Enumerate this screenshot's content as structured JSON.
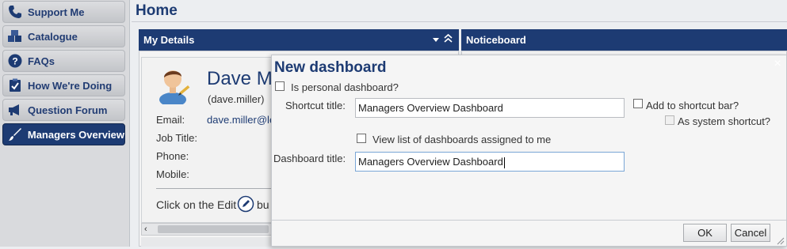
{
  "sidebar": {
    "items": [
      {
        "label": "Support Me",
        "icon": "phone-icon"
      },
      {
        "label": "Catalogue",
        "icon": "boxes-icon"
      },
      {
        "label": "FAQs",
        "icon": "question-icon"
      },
      {
        "label": "How We're Doing",
        "icon": "clipboard-icon"
      },
      {
        "label": "Question Forum",
        "icon": "megaphone-icon"
      },
      {
        "label": "Managers Overview",
        "icon": "brush-icon",
        "active": true
      }
    ]
  },
  "header": {
    "title": "Home"
  },
  "panels": {
    "my_details": {
      "title": "My Details",
      "name": "Dave Mi",
      "username": "(dave.miller)",
      "email_label": "Email:",
      "email_value": "dave.miller@le",
      "job_title_label": "Job Title:",
      "phone_label": "Phone:",
      "mobile_label": "Mobile:",
      "hint_prefix": "Click on the Edit",
      "hint_suffix": "bu"
    },
    "noticeboard": {
      "title": "Noticeboard"
    }
  },
  "dialog": {
    "title": "New dashboard",
    "close_symbol": "×",
    "personal_label": "Is personal dashboard?",
    "shortcut_title_label": "Shortcut title:",
    "shortcut_title_value": "Managers Overview Dashboard",
    "add_shortcut_label": "Add to shortcut bar?",
    "system_shortcut_label": "As system shortcut?",
    "view_list_label": "View list of dashboards assigned to me",
    "dashboard_title_label": "Dashboard title:",
    "dashboard_title_value": "Managers Overview Dashboard",
    "ok_label": "OK",
    "cancel_label": "Cancel"
  },
  "colors": {
    "brand": "#1d3b73",
    "sidebar_bg": "#d9dadd"
  }
}
